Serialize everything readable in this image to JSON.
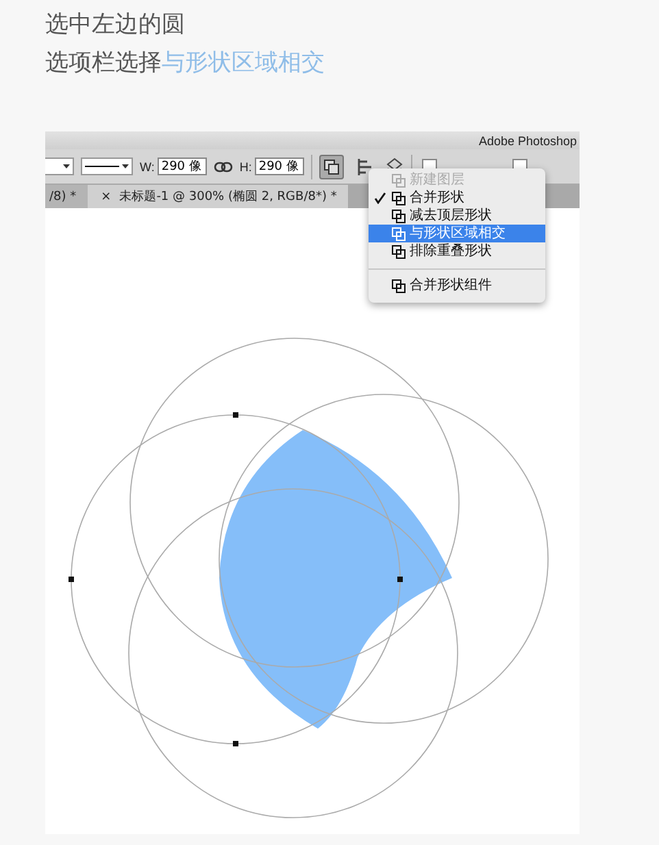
{
  "instructions": [
    {
      "text": "选中左边的圆"
    },
    {
      "text": "选项栏选择",
      "highlight": "与形状区域相交"
    }
  ],
  "app_title": "Adobe Photoshop",
  "options_bar": {
    "checkboxes": [
      {
        "checked": false
      },
      {
        "checked": false
      }
    ],
    "width_label": "W:",
    "width_value": "290 像",
    "height_label": "H:",
    "height_value": "290 像"
  },
  "tabs": [
    {
      "label": "/8) *",
      "selected": false
    },
    {
      "label": "未标题-1 @ 300% (椭圆 2, RGB/8*) *",
      "close": "×",
      "selected": true
    }
  ],
  "menu": [
    {
      "label": "新建图层",
      "disabled": true,
      "checked": false,
      "selected": false,
      "separator_before": false
    },
    {
      "label": "合并形状",
      "disabled": false,
      "checked": true,
      "selected": false,
      "separator_before": false
    },
    {
      "label": "减去顶层形状",
      "disabled": false,
      "checked": false,
      "selected": false,
      "separator_before": false
    },
    {
      "label": "与形状区域相交",
      "disabled": false,
      "checked": false,
      "selected": true,
      "separator_before": false
    },
    {
      "label": "排除重叠形状",
      "disabled": false,
      "checked": false,
      "selected": false,
      "separator_before": false
    },
    {
      "label": "合并形状组件",
      "disabled": false,
      "checked": false,
      "selected": false,
      "separator_before": true
    }
  ]
}
